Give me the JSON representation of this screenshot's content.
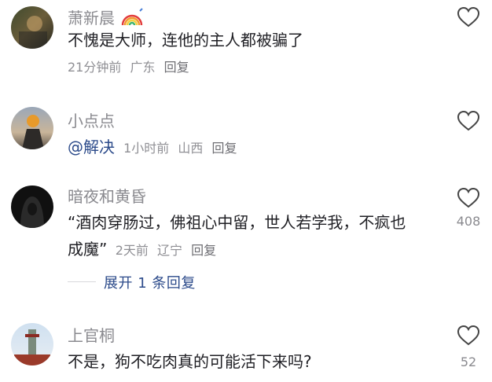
{
  "comments": [
    {
      "username": "萧新晨",
      "text": "不愧是大师，连他的主人都被骗了",
      "time": "21分钟前",
      "location": "广东",
      "reply_label": "回复",
      "likes": ""
    },
    {
      "username": "小点点",
      "mention": "@解决",
      "time": "1小时前",
      "location": "山西",
      "reply_label": "回复",
      "likes": ""
    },
    {
      "username": "暗夜和黄昏",
      "text_line1": "“酒肉穿肠过，佛祖心中留，世人若学我，不疯也",
      "text_line2": "成魔”",
      "time": "2天前",
      "location": "辽宁",
      "reply_label": "回复",
      "likes": "408",
      "expand_label": "展开 1 条回复"
    },
    {
      "username": "上官桐",
      "text": "不是，狗不吃肉真的可能活下来吗?",
      "likes": "52"
    }
  ],
  "icons": {
    "like": "heart-outline-icon",
    "badge": "rainbow-icon"
  },
  "colors": {
    "username": "#8a8a8f",
    "text": "#1f1f24",
    "link": "#2b4a8a"
  }
}
